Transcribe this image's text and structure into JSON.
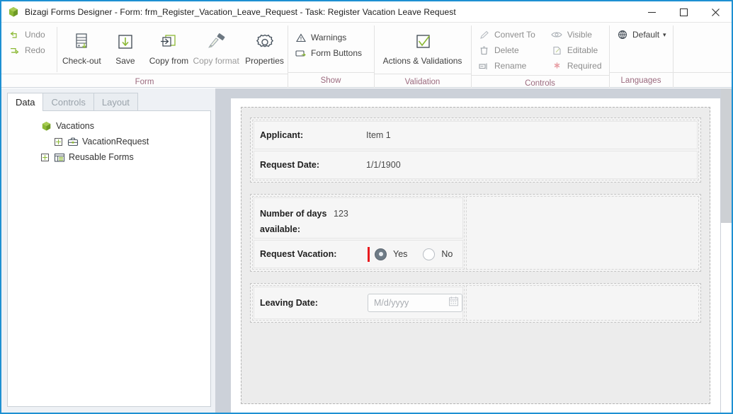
{
  "window": {
    "title": "Bizagi Forms Designer  - Form: frm_Register_Vacation_Leave_Request - Task:  Register Vacation Leave Request",
    "app_icon": "bizagi-cube-icon",
    "minimize_label": "—",
    "maximize_label": "☐",
    "close_label": "✕"
  },
  "ribbon": {
    "groups": [
      {
        "name": "form",
        "label": "Form",
        "small_buttons": [
          {
            "label": "Undo",
            "icon": "undo-icon",
            "enabled": false
          },
          {
            "label": "Redo",
            "icon": "redo-icon",
            "enabled": false
          }
        ],
        "large_buttons": [
          {
            "label": "Check-out",
            "icon": "check-out-icon",
            "enabled": true
          },
          {
            "label": "Save",
            "icon": "save-icon",
            "enabled": true
          },
          {
            "label": "Copy from",
            "icon": "copy-from-icon",
            "enabled": true
          },
          {
            "label": "Copy format",
            "icon": "copy-format-icon",
            "enabled": false
          },
          {
            "label": "Properties",
            "icon": "properties-gear-icon",
            "enabled": true
          }
        ]
      },
      {
        "name": "show",
        "label": "Show",
        "small_buttons": [
          {
            "label": "Warnings",
            "icon": "warning-triangle-icon",
            "enabled": true
          },
          {
            "label": "Form Buttons",
            "icon": "form-buttons-icon",
            "enabled": true
          }
        ],
        "large_buttons": []
      },
      {
        "name": "validation",
        "label": "Validation",
        "small_buttons": [],
        "large_buttons": [
          {
            "label": "Actions & Validations",
            "icon": "actions-validations-check-icon",
            "enabled": true
          }
        ]
      },
      {
        "name": "controls",
        "label": "Controls",
        "small_buttons": [
          {
            "label": "Convert To",
            "icon": "convert-to-pencil-icon",
            "enabled": false
          },
          {
            "label": "Delete",
            "icon": "delete-trash-icon",
            "enabled": false
          },
          {
            "label": "Rename",
            "icon": "rename-icon",
            "enabled": false
          },
          {
            "label": "Visible",
            "icon": "visible-eye-icon",
            "enabled": false
          },
          {
            "label": "Editable",
            "icon": "editable-icon",
            "enabled": false
          },
          {
            "label": "Required",
            "icon": "required-asterisk-icon",
            "enabled": false
          }
        ],
        "large_buttons": []
      },
      {
        "name": "languages",
        "label": "Languages",
        "small_buttons": [
          {
            "label": "Default",
            "icon": "language-globe-icon",
            "enabled": true,
            "dropdown": "▾"
          }
        ],
        "large_buttons": []
      }
    ]
  },
  "left_panel": {
    "tabs": [
      {
        "label": "Data",
        "active": true
      },
      {
        "label": "Controls",
        "active": false
      },
      {
        "label": "Layout",
        "active": false
      }
    ],
    "tree": [
      {
        "label": "Vacations",
        "icon": "cube-green-icon",
        "indent": 0,
        "expander": false
      },
      {
        "label": "VacationRequest",
        "icon": "entity-briefcase-icon",
        "indent": 1,
        "expander": true
      },
      {
        "label": "Reusable Forms",
        "icon": "reusable-forms-icon",
        "indent": 0,
        "expander": true
      }
    ]
  },
  "form": {
    "groups": [
      {
        "name": "applicant-group",
        "rows": [
          {
            "label": "Applicant:",
            "value": "Item 1",
            "type": "text"
          },
          {
            "label": "Request Date:",
            "value": "1/1/1900",
            "type": "text"
          }
        ]
      },
      {
        "name": "vacation-group",
        "rows": [
          {
            "label": "Number of days available:",
            "value": "123",
            "type": "text"
          },
          {
            "label": "Request Vacation:",
            "type": "radio",
            "selected": "Yes",
            "options": [
              {
                "label": "Yes",
                "checked": true
              },
              {
                "label": "No",
                "checked": false
              }
            ],
            "drag_marker": true
          }
        ]
      },
      {
        "name": "leaving-date-group",
        "rows": [
          {
            "label": "Leaving Date:",
            "type": "date",
            "value": "",
            "placeholder": "M/d/yyyy",
            "icon": "calendar-icon"
          }
        ]
      }
    ]
  },
  "colors": {
    "window_border": "#1e90d2",
    "accent_green": "#8cb935",
    "group_label": "#9b6a7e",
    "drag_marker_red": "#e8191d",
    "radio_checked": "#6e7b86",
    "canvas_backdrop": "#ccd1d9"
  }
}
